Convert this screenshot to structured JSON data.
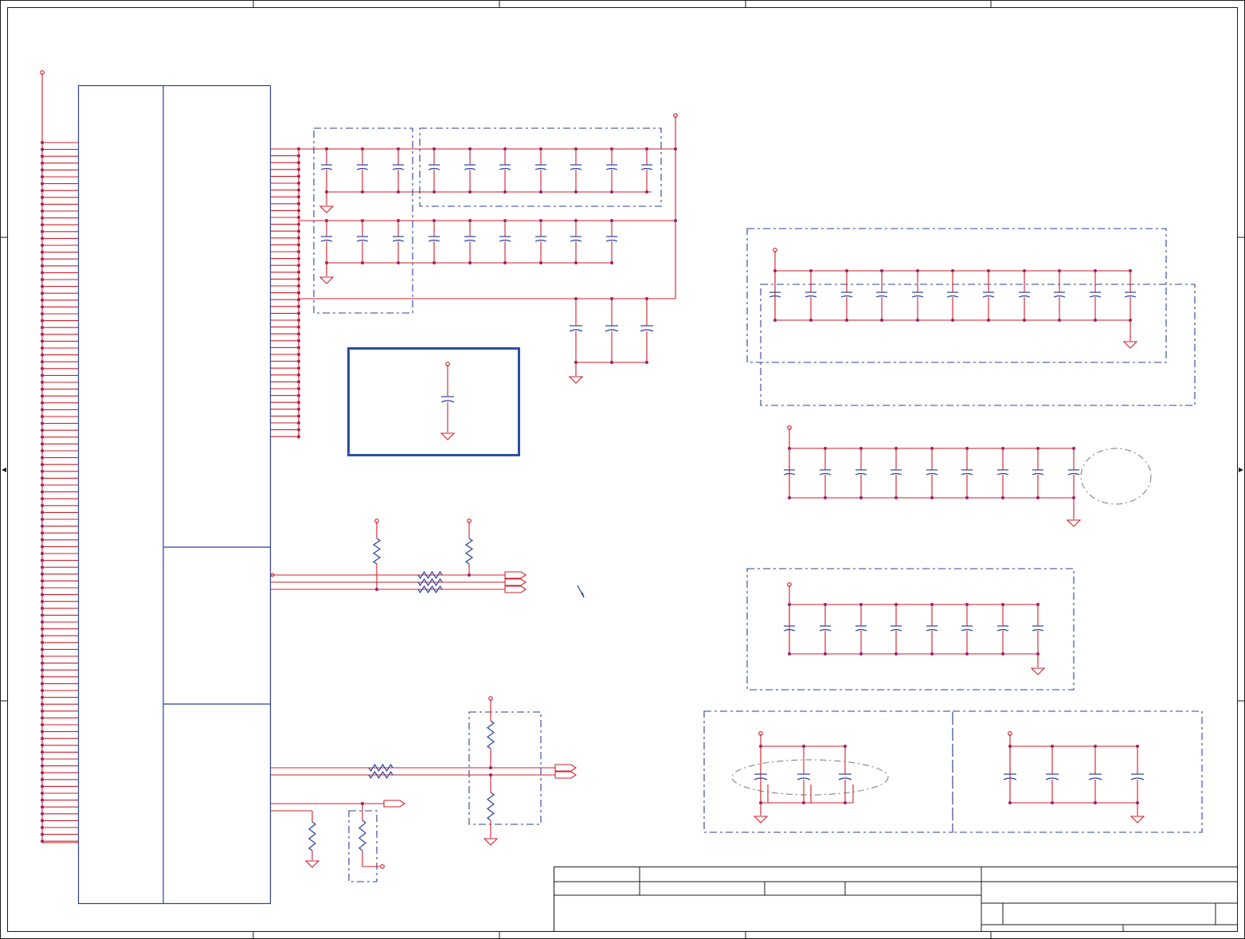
{
  "schematic": {
    "colors": {
      "wire": "#d21f2b",
      "component": "#2b3f9c",
      "border": "#1a1a1a",
      "junction": "#9e1f6a"
    },
    "icons": [
      "capacitor-icon",
      "resistor-icon",
      "ground-icon",
      "power-pin-icon",
      "offpage-connector-icon"
    ],
    "title_block": {
      "visible_text": []
    }
  }
}
